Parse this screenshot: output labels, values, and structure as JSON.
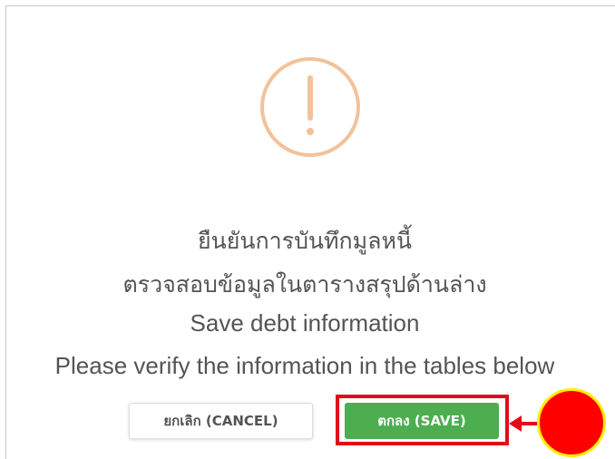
{
  "dialog": {
    "icon": "exclamation-circle-icon",
    "icon_color": "#f2c29b",
    "title_th": "ยืนยันการบันทึกมูลหนี้",
    "subtitle_th": "ตรวจสอบข้อมูลในตารางสรุปด้านล่าง",
    "title_en": "Save debt information",
    "subtitle_en": "Please verify the information in the tables below",
    "buttons": {
      "cancel_label": "ยกเลิก (CANCEL)",
      "save_label": "ตกลง (SAVE)",
      "save_color": "#4cae4f"
    }
  },
  "annotation": {
    "highlight_color": "#e30b17",
    "marker_color": "#ff0000",
    "marker_border": "#ffee00"
  }
}
